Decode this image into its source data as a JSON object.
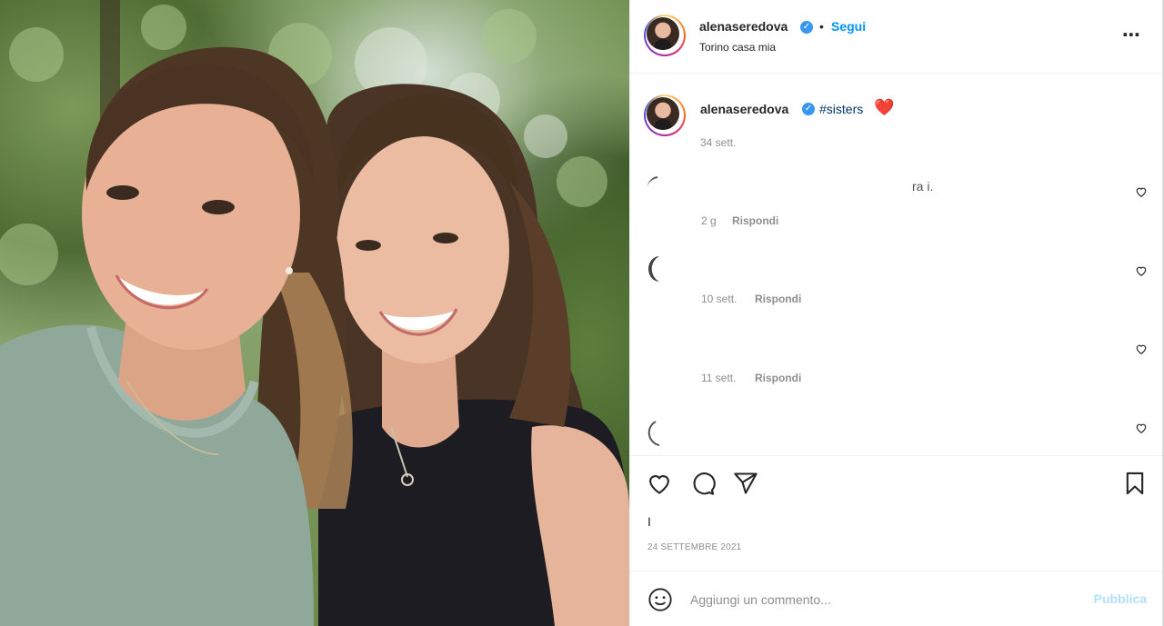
{
  "header": {
    "username": "alenaseredova",
    "verified_icon": "verified-badge",
    "separator": "•",
    "follow_label": "Segui",
    "location": "Torino casa mia",
    "more_icon": "more-options-icon"
  },
  "caption": {
    "username": "alenaseredova",
    "hashtag": "#sisters",
    "emoji": "❤️",
    "time": "34 sett."
  },
  "comments": [
    {
      "text": "ra i.",
      "time": "2 g",
      "reply_label": "Rispondi"
    },
    {
      "text": "",
      "time": "10 sett.",
      "reply_label": "Rispondi"
    },
    {
      "text": "",
      "time": "11 sett.",
      "reply_label": "Rispondi"
    },
    {
      "text": "",
      "time": "",
      "reply_label": ""
    }
  ],
  "actions": {
    "like_icon": "heart-icon",
    "comment_icon": "comment-icon",
    "share_icon": "share-icon",
    "save_icon": "bookmark-icon"
  },
  "likes_text": "I",
  "post_date": "24 SETTEMBRE 2021",
  "comment_box": {
    "emoji_icon": "emoji-icon",
    "placeholder": "Aggiungi un commento...",
    "publish_label": "Pubblica"
  },
  "colors": {
    "accent": "#0095f6",
    "verified": "#3897f0",
    "publish_disabled": "#b2dffc",
    "muted": "#8e8e8e"
  }
}
